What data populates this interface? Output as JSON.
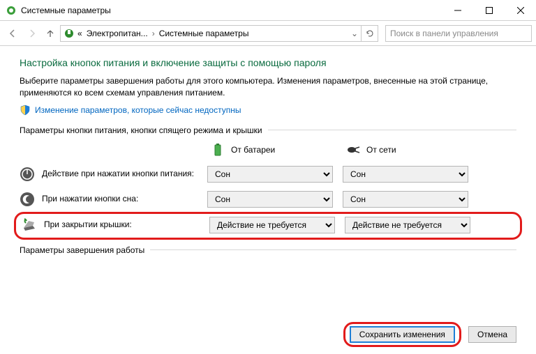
{
  "titlebar": {
    "title": "Системные параметры"
  },
  "breadcrumb": {
    "item1": "Электропитан...",
    "item2": "Системные параметры",
    "prefix": "«"
  },
  "search": {
    "placeholder": "Поиск в панели управления"
  },
  "heading": "Настройка кнопок питания и включение защиты с помощью пароля",
  "description": "Выберите параметры завершения работы для этого компьютера. Изменения параметров, внесенные на этой странице, применяются ко всем схемам управления питанием.",
  "shield_link": "Изменение параметров, которые сейчас недоступны",
  "section1": "Параметры кнопки питания, кнопки спящего режима и крышки",
  "columns": {
    "battery": "От батареи",
    "ac": "От сети"
  },
  "rows": {
    "power_btn": {
      "label": "Действие при нажатии кнопки питания:",
      "battery": "Сон",
      "ac": "Сон"
    },
    "sleep_btn": {
      "label": "При нажатии кнопки сна:",
      "battery": "Сон",
      "ac": "Сон"
    },
    "lid": {
      "label": "При закрытии крышки:",
      "battery": "Действие не требуется",
      "ac": "Действие не требуется"
    }
  },
  "section2": "Параметры завершения работы",
  "footer": {
    "save": "Сохранить изменения",
    "cancel": "Отмена"
  }
}
